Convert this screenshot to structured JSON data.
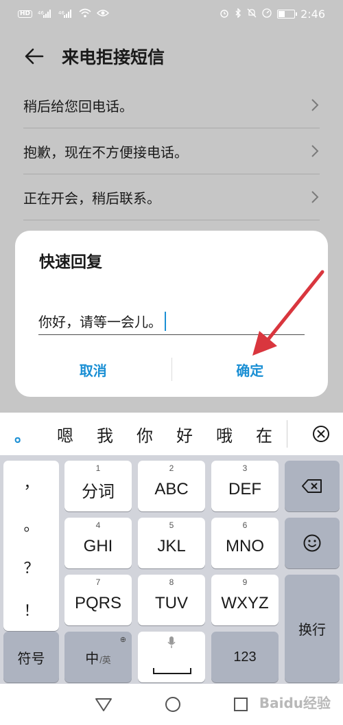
{
  "status_bar": {
    "left_badge": "HD",
    "signal1": "⁴⁶",
    "signal2": "⁴⁶",
    "time": "2:46"
  },
  "header": {
    "title": "来电拒接短信"
  },
  "reply_list": {
    "items": [
      {
        "label": "稍后给您回电话。"
      },
      {
        "label": "抱歉，现在不方便接电话。"
      },
      {
        "label": "正在开会，稍后联系。"
      }
    ]
  },
  "dialog": {
    "title": "快速回复",
    "input_value": "你好，请等一会儿。",
    "cancel_label": "取消",
    "confirm_label": "确定"
  },
  "candidate_bar": {
    "punct": "。",
    "candidates": [
      "嗯",
      "我",
      "你",
      "好",
      "哦",
      "在"
    ]
  },
  "keyboard": {
    "punctuation": [
      "，",
      "。",
      "？",
      "！"
    ],
    "keys": [
      {
        "num": "1",
        "label": "分词"
      },
      {
        "num": "2",
        "label": "ABC"
      },
      {
        "num": "3",
        "label": "DEF"
      },
      {
        "num": "4",
        "label": "GHI"
      },
      {
        "num": "5",
        "label": "JKL"
      },
      {
        "num": "6",
        "label": "MNO"
      },
      {
        "num": "7",
        "label": "PQRS"
      },
      {
        "num": "8",
        "label": "TUV"
      },
      {
        "num": "9",
        "label": "WXYZ"
      },
      {
        "num": "0",
        "label": ""
      }
    ],
    "symbols_label": "符号",
    "lang_main": "中",
    "lang_sub": "/英",
    "num_label": "123",
    "enter_label": "换行"
  },
  "accent_color": "#1a8fd4",
  "annotation_color": "#d9363e",
  "watermark": "Baidu经验"
}
